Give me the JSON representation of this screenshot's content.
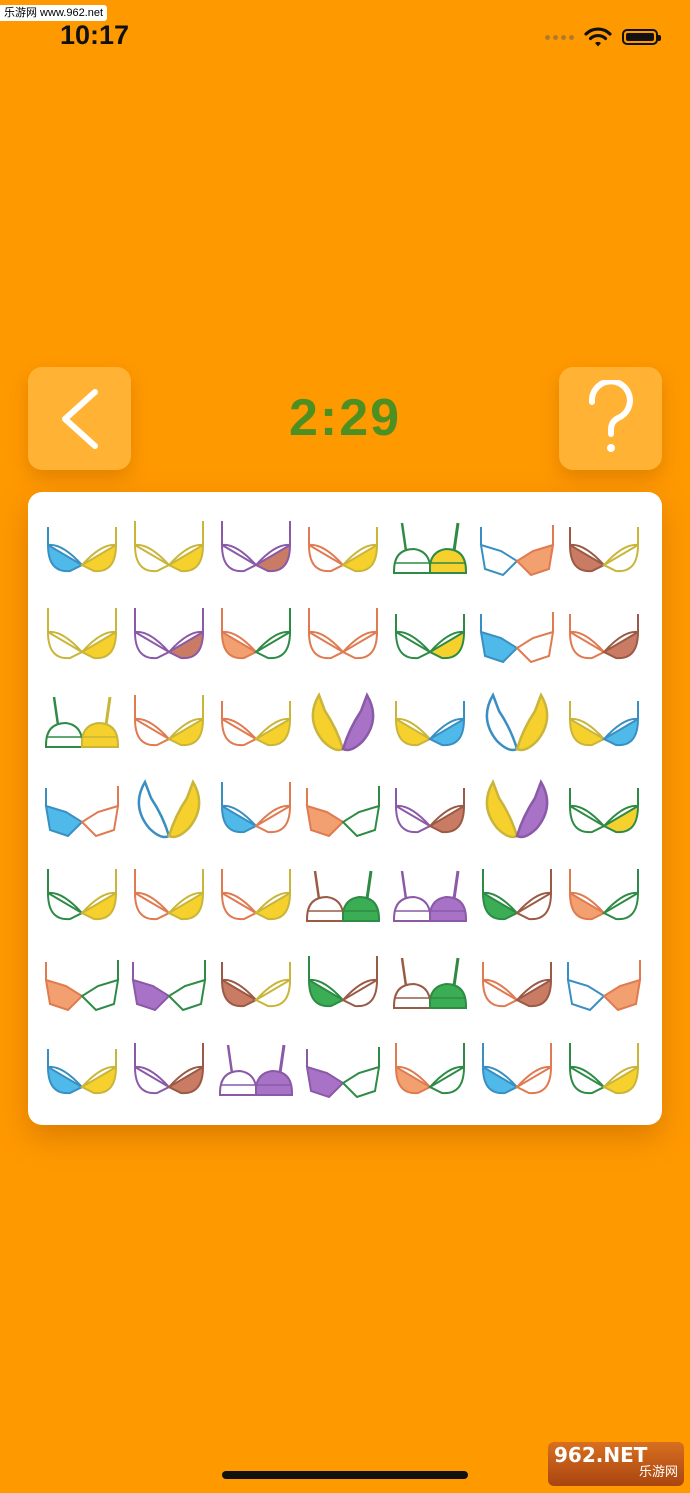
{
  "watermark_top": "乐游网 www.962.net",
  "status": {
    "time": "10:17"
  },
  "game": {
    "timer": "2:29"
  },
  "watermark_bottom": {
    "brand": "962.NET",
    "sub": "乐游网"
  },
  "palette": {
    "blue": "#4FB9EA",
    "yellow": "#F6D12E",
    "purple": "#A872C6",
    "brown": "#C97B63",
    "salmon": "#F2A070",
    "green": "#3BAE55",
    "mustard": "#C9B53A",
    "coral": "#EF8A5B",
    "white": "#FFFFFF"
  },
  "board": {
    "rows": 7,
    "cols": 7,
    "tiles": [
      {
        "shape": "cups",
        "left": "blue",
        "right": "yellow",
        "lineL": "#3A8FC2",
        "lineR": "#C9B53A"
      },
      {
        "shape": "strap",
        "left": "white",
        "right": "yellow",
        "lineL": "#C9B53A",
        "lineR": "#C9B53A"
      },
      {
        "shape": "strap",
        "left": "white",
        "right": "brown",
        "lineL": "#8A5AA8",
        "lineR": "#8A5AA8"
      },
      {
        "shape": "cups",
        "left": "white",
        "right": "yellow",
        "lineL": "#E07A50",
        "lineR": "#C9B53A"
      },
      {
        "shape": "frame",
        "left": "white",
        "right": "yellow",
        "lineL": "#2E8B45",
        "lineR": "#2E8B45"
      },
      {
        "shape": "angular",
        "left": "white",
        "right": "salmon",
        "lineL": "#3A8FC2",
        "lineR": "#E07A50"
      },
      {
        "shape": "cups",
        "left": "brown",
        "right": "white",
        "lineL": "#9A5A46",
        "lineR": "#C9B53A"
      },
      {
        "shape": "strap",
        "left": "white",
        "right": "yellow",
        "lineL": "#C9B53A",
        "lineR": "#C9B53A"
      },
      {
        "shape": "strap",
        "left": "white",
        "right": "brown",
        "lineL": "#8A5AA8",
        "lineR": "#8A5AA8"
      },
      {
        "shape": "strap",
        "left": "salmon",
        "right": "white",
        "lineL": "#E07A50",
        "lineR": "#2E8B45"
      },
      {
        "shape": "strap",
        "left": "white",
        "right": "white",
        "lineL": "#E07A50",
        "lineR": "#E07A50"
      },
      {
        "shape": "cups",
        "left": "white",
        "right": "yellow",
        "lineL": "#2E8B45",
        "lineR": "#2E8B45"
      },
      {
        "shape": "angular",
        "left": "blue",
        "right": "white",
        "lineL": "#3A8FC2",
        "lineR": "#E07A50"
      },
      {
        "shape": "cups",
        "left": "white",
        "right": "brown",
        "lineL": "#E07A50",
        "lineR": "#9A5A46"
      },
      {
        "shape": "frame",
        "left": "white",
        "right": "yellow",
        "lineL": "#2E8B45",
        "lineR": "#C9B53A"
      },
      {
        "shape": "strap",
        "left": "white",
        "right": "yellow",
        "lineL": "#E07A50",
        "lineR": "#C9B53A"
      },
      {
        "shape": "cups",
        "left": "white",
        "right": "yellow",
        "lineL": "#E07A50",
        "lineR": "#C9B53A"
      },
      {
        "shape": "plunge",
        "left": "yellow",
        "right": "purple",
        "lineL": "#C9B53A",
        "lineR": "#8A5AA8"
      },
      {
        "shape": "cups",
        "left": "yellow",
        "right": "blue",
        "lineL": "#C9B53A",
        "lineR": "#3A8FC2"
      },
      {
        "shape": "plunge",
        "left": "white",
        "right": "yellow",
        "lineL": "#3A8FC2",
        "lineR": "#C9B53A"
      },
      {
        "shape": "cups",
        "left": "yellow",
        "right": "blue",
        "lineL": "#C9B53A",
        "lineR": "#3A8FC2"
      },
      {
        "shape": "angular",
        "left": "blue",
        "right": "white",
        "lineL": "#3A8FC2",
        "lineR": "#E07A50"
      },
      {
        "shape": "plunge",
        "left": "white",
        "right": "yellow",
        "lineL": "#3A8FC2",
        "lineR": "#C9B53A"
      },
      {
        "shape": "strap",
        "left": "blue",
        "right": "white",
        "lineL": "#3A8FC2",
        "lineR": "#E07A50"
      },
      {
        "shape": "angular",
        "left": "salmon",
        "right": "white",
        "lineL": "#E07A50",
        "lineR": "#2E8B45"
      },
      {
        "shape": "cups",
        "left": "white",
        "right": "brown",
        "lineL": "#8A5AA8",
        "lineR": "#9A5A46"
      },
      {
        "shape": "plunge",
        "left": "yellow",
        "right": "purple",
        "lineL": "#C9B53A",
        "lineR": "#8A5AA8"
      },
      {
        "shape": "cups",
        "left": "white",
        "right": "yellow",
        "lineL": "#2E8B45",
        "lineR": "#2E8B45"
      },
      {
        "shape": "strap",
        "left": "white",
        "right": "yellow",
        "lineL": "#2E8B45",
        "lineR": "#C9B53A"
      },
      {
        "shape": "strap",
        "left": "white",
        "right": "yellow",
        "lineL": "#E07A50",
        "lineR": "#C9B53A"
      },
      {
        "shape": "strap",
        "left": "white",
        "right": "yellow",
        "lineL": "#E07A50",
        "lineR": "#C9B53A"
      },
      {
        "shape": "frame",
        "left": "white",
        "right": "green",
        "lineL": "#9A5A46",
        "lineR": "#2E8B45"
      },
      {
        "shape": "frame",
        "left": "white",
        "right": "purple",
        "lineL": "#8A5AA8",
        "lineR": "#8A5AA8"
      },
      {
        "shape": "strap",
        "left": "green",
        "right": "white",
        "lineL": "#2E8B45",
        "lineR": "#9A5A46"
      },
      {
        "shape": "strap",
        "left": "salmon",
        "right": "white",
        "lineL": "#E07A50",
        "lineR": "#2E8B45"
      },
      {
        "shape": "angular",
        "left": "salmon",
        "right": "white",
        "lineL": "#E07A50",
        "lineR": "#2E8B45"
      },
      {
        "shape": "angular",
        "left": "purple",
        "right": "white",
        "lineL": "#8A5AA8",
        "lineR": "#2E8B45"
      },
      {
        "shape": "cups",
        "left": "brown",
        "right": "white",
        "lineL": "#9A5A46",
        "lineR": "#C9B53A"
      },
      {
        "shape": "strap",
        "left": "green",
        "right": "white",
        "lineL": "#2E8B45",
        "lineR": "#9A5A46"
      },
      {
        "shape": "frame",
        "left": "white",
        "right": "green",
        "lineL": "#9A5A46",
        "lineR": "#2E8B45"
      },
      {
        "shape": "cups",
        "left": "white",
        "right": "brown",
        "lineL": "#E07A50",
        "lineR": "#9A5A46"
      },
      {
        "shape": "angular",
        "left": "white",
        "right": "salmon",
        "lineL": "#3A8FC2",
        "lineR": "#E07A50"
      },
      {
        "shape": "cups",
        "left": "blue",
        "right": "yellow",
        "lineL": "#3A8FC2",
        "lineR": "#C9B53A"
      },
      {
        "shape": "strap",
        "left": "white",
        "right": "brown",
        "lineL": "#8A5AA8",
        "lineR": "#9A5A46"
      },
      {
        "shape": "frame",
        "left": "white",
        "right": "purple",
        "lineL": "#8A5AA8",
        "lineR": "#8A5AA8"
      },
      {
        "shape": "angular",
        "left": "purple",
        "right": "white",
        "lineL": "#8A5AA8",
        "lineR": "#2E8B45"
      },
      {
        "shape": "strap",
        "left": "salmon",
        "right": "white",
        "lineL": "#E07A50",
        "lineR": "#2E8B45"
      },
      {
        "shape": "strap",
        "left": "blue",
        "right": "white",
        "lineL": "#3A8FC2",
        "lineR": "#E07A50"
      },
      {
        "shape": "strap",
        "left": "white",
        "right": "yellow",
        "lineL": "#2E8B45",
        "lineR": "#C9B53A"
      }
    ]
  }
}
